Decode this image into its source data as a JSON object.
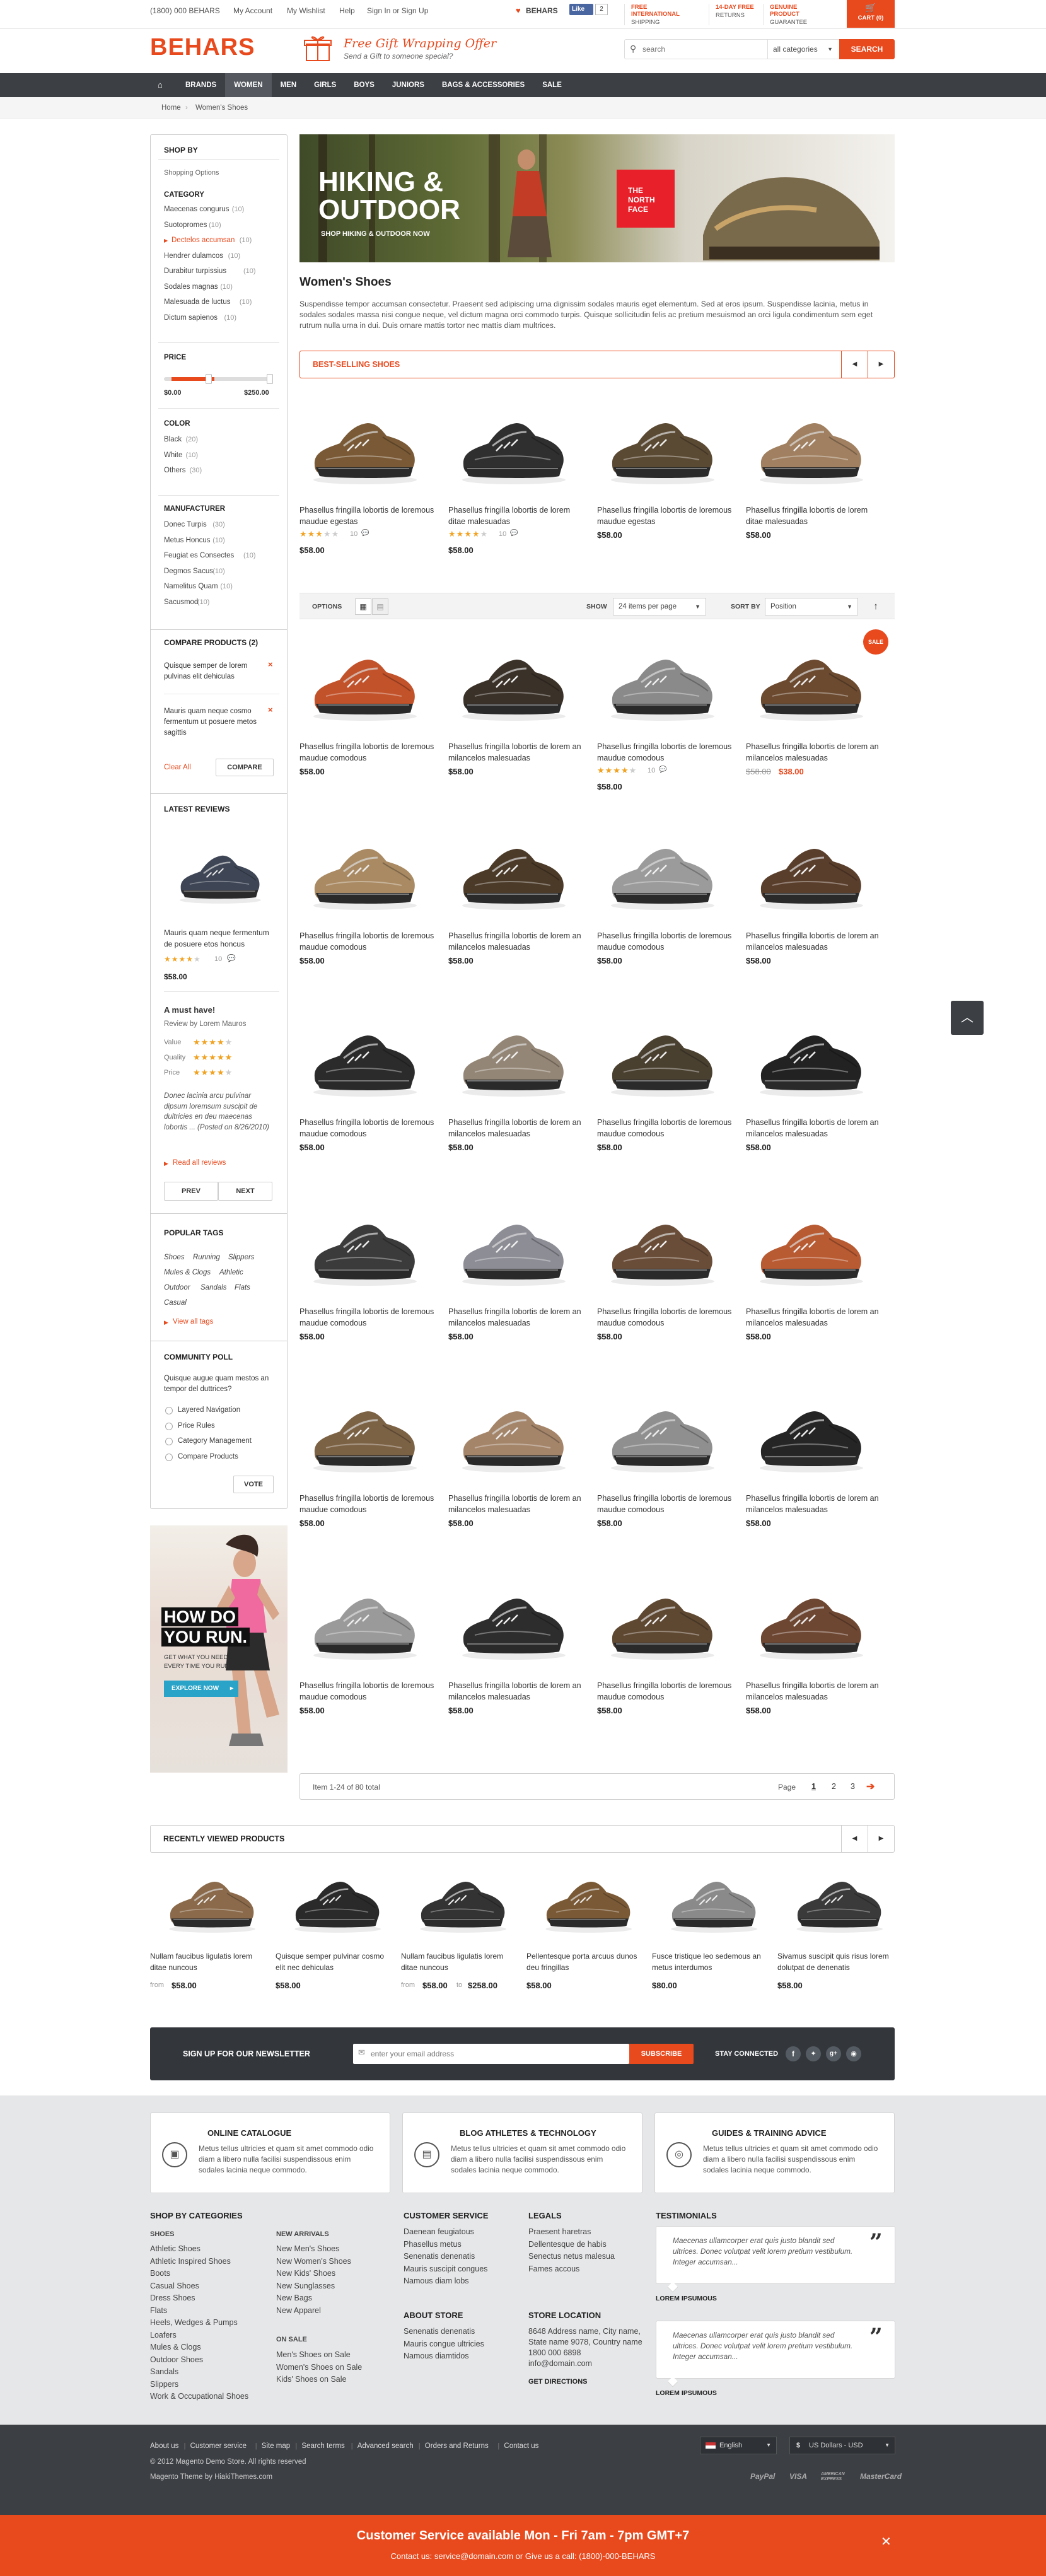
{
  "topbar": {
    "phone": "(1800) 000 BEHARS",
    "links": [
      "My Account",
      "My Wishlist",
      "Help",
      "Sign In or Sign Up"
    ],
    "like_brand": "BEHARS",
    "fb_like": "Like",
    "fb_count": "2",
    "promos": [
      {
        "l1": "FREE INTERNATIONAL",
        "l2": "SHIPPING"
      },
      {
        "l1": "14-DAY FREE",
        "l2": "RETURNS"
      },
      {
        "l1": "GENUINE PRODUCT",
        "l2": "GUARANTEE"
      }
    ],
    "cart": "CART (0)"
  },
  "header": {
    "logo": "BEHARS",
    "gift_title": "Free Gift Wrapping Offer",
    "gift_sub": "Send a Gift to someone special?",
    "search_placeholder": "search",
    "category": "all categories",
    "search_btn": "SEARCH"
  },
  "nav": {
    "items": [
      "BRANDS",
      "WOMEN",
      "MEN",
      "GIRLS",
      "BOYS",
      "JUNIORS",
      "BAGS & ACCESSORIES",
      "SALE"
    ],
    "active": "WOMEN"
  },
  "breadcrumb": [
    "Home",
    "Women's Shoes"
  ],
  "sidebar": {
    "shop_by": "SHOP BY",
    "shopping_options": "Shopping Options",
    "category_title": "CATEGORY",
    "categories": [
      {
        "name": "Maecenas congurus",
        "count": "(10)"
      },
      {
        "name": "Suotopromes",
        "count": "(10)"
      },
      {
        "name": "Dectelos accumsan",
        "count": "(10)",
        "active": true
      },
      {
        "name": "Hendrer dulamcos",
        "count": "(10)"
      },
      {
        "name": "Durabitur turpissius",
        "count": "(10)"
      },
      {
        "name": "Sodales magnas",
        "count": "(10)"
      },
      {
        "name": "Malesuada de luctus",
        "count": "(10)"
      },
      {
        "name": "Dictum sapienos",
        "count": "(10)"
      }
    ],
    "price_title": "PRICE",
    "price_min": "$0.00",
    "price_max": "$250.00",
    "price_range": [
      0.07,
      0.95
    ],
    "color_title": "COLOR",
    "colors": [
      {
        "name": "Black",
        "count": "(20)"
      },
      {
        "name": "White",
        "count": "(10)"
      },
      {
        "name": "Others",
        "count": "(30)"
      }
    ],
    "manufacturer_title": "MANUFACTURER",
    "manufacturers": [
      {
        "name": "Donec Turpis",
        "count": "(30)"
      },
      {
        "name": "Metus Honcus",
        "count": "(10)"
      },
      {
        "name": "Feugiat es Consectes",
        "count": "(10)"
      },
      {
        "name": "Degmos Sacus",
        "count": "(10)"
      },
      {
        "name": "Namelitus Quam",
        "count": "(10)"
      },
      {
        "name": "Sacusmod",
        "count": "(10)"
      }
    ],
    "compare_title": "COMPARE PRODUCTS (2)",
    "compare_items": [
      "Quisque semper de lorem pulvinas elit dehiculas",
      "Mauris quam neque cosmo fermentum ut posuere metos sagittis"
    ],
    "clear_all": "Clear All",
    "compare_btn": "COMPARE",
    "reviews_title": "LATEST REVIEWS",
    "review_product": "Mauris quam neque fermentum de posuere etos honcus",
    "review_count": "10",
    "review_price": "$58.00",
    "review_head": "A must have!",
    "review_by": "Review by Lorem Mauros",
    "ratings": [
      {
        "label": "Value",
        "stars": 4
      },
      {
        "label": "Quality",
        "stars": 5
      },
      {
        "label": "Price",
        "stars": 4
      }
    ],
    "review_text": "Donec lacinia arcu pulvinar dipsum loremsum suscipit de dultricies en deu maecenas lobortis ... (Posted on 8/26/2010)",
    "read_all": "Read all reviews",
    "prev": "PREV",
    "next": "NEXT",
    "tags_title": "POPULAR TAGS",
    "tags": [
      "Shoes",
      "Running",
      "Slippers",
      "Mules & Clogs",
      "Athletic",
      "Outdoor",
      "Sandals",
      "Flats",
      "Casual"
    ],
    "view_tags": "View all tags",
    "poll_title": "COMMUNITY POLL",
    "poll_q": "Quisque augue quam mestos an tempor del duttrices?",
    "poll_opts": [
      "Layered Navigation",
      "Price Rules",
      "Category Management",
      "Compare Products"
    ],
    "vote": "VOTE",
    "ad": {
      "title1": "HOW DO",
      "title2": "YOU RUN.",
      "sub1": "GET WHAT YOU NEED,",
      "sub2": "EVERY TIME YOU RUN.",
      "btn": "EXPLORE NOW"
    }
  },
  "banner": {
    "title1": "HIKING &",
    "title2": "OUTDOOR",
    "sub": "SHOP HIKING & OUTDOOR NOW",
    "brand1": "THE",
    "brand2": "NORTH",
    "brand3": "FACE"
  },
  "main": {
    "title": "Women's Shoes",
    "desc": "Suspendisse tempor accumsan consectetur. Praesent sed adipiscing urna dignissim sodales mauris eget elementum. Sed at eros ipsum. Suspendisse lacinia, metus in sodales sodales massa nisi congue neque, vel dictum magna orci commodo turpis. Quisque sollicitudin felis ac pretium mesuismod an orci ligula condimentum sem eget rutrum nulla urna in dui. Duis ornare mattis tortor nec mattis diam multrices.",
    "bestselling_title": "BEST-SELLING SHOES",
    "bestselling": [
      {
        "name": "Phasellus fringilla lobortis de loremous maudue egestas",
        "price": "$58.00",
        "stars": 3,
        "reviews": "10",
        "c": "#7a5a36"
      },
      {
        "name": "Phasellus fringilla lobortis de lorem ditae malesuadas",
        "price": "$58.00",
        "stars": 4,
        "reviews": "10",
        "c": "#2f2f2f"
      },
      {
        "name": "Phasellus fringilla lobortis de loremous maudue egestas",
        "price": "$58.00",
        "c": "#5b4a33"
      },
      {
        "name": "Phasellus fringilla lobortis de lorem ditae malesuadas",
        "price": "$58.00",
        "c": "#a08060"
      }
    ],
    "toolbar": {
      "options": "OPTIONS",
      "show": "SHOW",
      "per_page": "24 items per page",
      "sort_by": "SORT BY",
      "sort": "Position"
    },
    "products": [
      {
        "name": "Phasellus fringilla lobortis de loremous maudue comodous",
        "price": "$58.00",
        "c": "#c2522a"
      },
      {
        "name": "Phasellus fringilla lobortis de lorem an milancelos malesuadas",
        "price": "$58.00",
        "c": "#3a3128"
      },
      {
        "name": "Phasellus fringilla lobortis de loremous maudue comodous",
        "price": "$58.00",
        "stars": 4,
        "reviews": "10",
        "c": "#8a8a8a"
      },
      {
        "name": "Phasellus fringilla lobortis de lorem an milancelos malesuadas",
        "old_price": "$58.00",
        "price": "$38.00",
        "sale": "SALE",
        "c": "#6b4a30"
      },
      {
        "name": "Phasellus fringilla lobortis de loremous maudue comodous",
        "price": "$58.00",
        "c": "#a98a63"
      },
      {
        "name": "Phasellus fringilla lobortis de lorem an milancelos malesuadas",
        "price": "$58.00",
        "c": "#4b3a28"
      },
      {
        "name": "Phasellus fringilla lobortis de loremous maudue comodous",
        "price": "$58.00",
        "c": "#9b9b9b"
      },
      {
        "name": "Phasellus fringilla lobortis de lorem an milancelos malesuadas",
        "price": "$58.00",
        "c": "#5a3e2c"
      },
      {
        "name": "Phasellus fringilla lobortis de loremous maudue comodous",
        "price": "$58.00",
        "c": "#2b2b2b"
      },
      {
        "name": "Phasellus fringilla lobortis de lorem an milancelos malesuadas",
        "price": "$58.00",
        "c": "#948676"
      },
      {
        "name": "Phasellus fringilla lobortis de loremous maudue comodous",
        "price": "$58.00",
        "c": "#4a4030"
      },
      {
        "name": "Phasellus fringilla lobortis de lorem an milancelos malesuadas",
        "price": "$58.00",
        "c": "#222222"
      },
      {
        "name": "Phasellus fringilla lobortis de loremous maudue comodous",
        "price": "$58.00",
        "c": "#3b3b3b"
      },
      {
        "name": "Phasellus fringilla lobortis de lorem an milancelos malesuadas",
        "price": "$58.00",
        "c": "#8d8d96"
      },
      {
        "name": "Phasellus fringilla lobortis de loremous maudue comodous",
        "price": "$58.00",
        "c": "#6a4d38"
      },
      {
        "name": "Phasellus fringilla lobortis de lorem an milancelos malesuadas",
        "price": "$58.00",
        "c": "#b85a32"
      },
      {
        "name": "Phasellus fringilla lobortis de loremous maudue comodous",
        "price": "$58.00",
        "c": "#7c6245"
      },
      {
        "name": "Phasellus fringilla lobortis de lorem an milancelos malesuadas",
        "price": "$58.00",
        "c": "#a4856a"
      },
      {
        "name": "Phasellus fringilla lobortis de loremous maudue comodous",
        "price": "$58.00",
        "c": "#8f8f8f"
      },
      {
        "name": "Phasellus fringilla lobortis de lorem an milancelos malesuadas",
        "price": "$58.00",
        "c": "#252525"
      },
      {
        "name": "Phasellus fringilla lobortis de loremous maudue comodous",
        "price": "$58.00",
        "c": "#9a9a9a"
      },
      {
        "name": "Phasellus fringilla lobortis de lorem an milancelos malesuadas",
        "price": "$58.00",
        "c": "#2d2d2d"
      },
      {
        "name": "Phasellus fringilla lobortis de loremous maudue comodous",
        "price": "$58.00",
        "c": "#5e4832"
      },
      {
        "name": "Phasellus fringilla lobortis de lorem an milancelos malesuadas",
        "price": "$58.00",
        "c": "#6e4733"
      }
    ],
    "pager": {
      "total": "Item 1-24 of 80 total",
      "page": "Page",
      "pages": [
        "1",
        "2",
        "3"
      ],
      "current": "1"
    }
  },
  "recent": {
    "title": "RECENTLY VIEWED PRODUCTS",
    "items": [
      {
        "name": "Nullam faucibus ligulatis lorem ditae nuncous",
        "from": "from",
        "price": "$58.00",
        "c": "#8a6a4a"
      },
      {
        "name": "Quisque semper pulvinar cosmo elit nec dehiculas",
        "price": "$58.00",
        "c": "#2a2a2a"
      },
      {
        "name": "Nullam faucibus ligulatis lorem ditae nuncous",
        "from": "from",
        "price": "$58.00",
        "to": "to",
        "price2": "$258.00",
        "c": "#333333"
      },
      {
        "name": "Pellentesque porta arcuus dunos deu fringillas",
        "price": "$58.00",
        "c": "#7a5a36"
      },
      {
        "name": "Fusce tristique leo sedemous an metus interdumos",
        "price": "$80.00",
        "c": "#8a8a8a"
      },
      {
        "name": "Sivamus suscipit quis risus lorem dolutpat de denenatis",
        "price": "$58.00",
        "c": "#3a3a3a"
      }
    ]
  },
  "newsletter": {
    "title": "SIGN UP FOR OUR NEWSLETTER",
    "placeholder": "enter your email address",
    "btn": "SUBSCRIBE",
    "stay": "STAY CONNECTED"
  },
  "features": [
    {
      "title": "ONLINE CATALOGUE",
      "text": "Metus tellus ultricies et quam sit amet commodo odio diam a libero nulla facilisi suspendissous enim sodales lacinia neque commodo."
    },
    {
      "title": "BLOG ATHLETES & TECHNOLOGY",
      "text": "Metus tellus ultricies et quam sit amet commodo odio diam a libero nulla facilisi suspendissous enim sodales lacinia neque commodo."
    },
    {
      "title": "GUIDES & TRAINING ADVICE",
      "text": "Metus tellus ultricies et quam sit amet commodo odio diam a libero nulla facilisi suspendissous enim sodales lacinia neque commodo."
    }
  ],
  "footer": {
    "shop_title": "SHOP BY CATEGORIES",
    "shoes_title": "SHOES",
    "shoes": [
      "Athletic Shoes",
      "Athletic Inspired Shoes",
      "Boots",
      "Casual Shoes",
      "Dress Shoes",
      "Flats",
      "Heels, Wedges & Pumps",
      "Loafers",
      "Mules & Clogs",
      "Outdoor Shoes",
      "Sandals",
      "Slippers",
      "Work & Occupational Shoes"
    ],
    "arrivals_title": "NEW ARRIVALS",
    "arrivals": [
      "New Men's Shoes",
      "New Women's Shoes",
      "New Kids' Shoes",
      "New Sunglasses",
      "New Bags",
      "New Apparel"
    ],
    "sale_title": "ON SALE",
    "sale": [
      "Men's Shoes on Sale",
      "Women's Shoes on Sale",
      "Kids' Shoes on Sale"
    ],
    "cs_title": "CUSTOMER SERVICE",
    "cs": [
      "Daenean feugiatous",
      "Phasellus metus",
      "Senenatis denenatis",
      "Mauris suscipit congues",
      "Namous diam lobs"
    ],
    "legal_title": "LEGALS",
    "legal": [
      "Praesent haretras",
      "Dellentesque de habis",
      "Senectus netus malesua",
      "Fames accous"
    ],
    "about_title": "ABOUT STORE",
    "about": [
      "Senenatis denenatis",
      "Mauris congue ultricies",
      "Namous diamtidos"
    ],
    "loc_title": "STORE LOCATION",
    "loc": [
      "8648 Address name, City name,",
      "State name 9078, Country name",
      "1800 000 6898",
      "info@domain.com"
    ],
    "directions": "GET DIRECTIONS",
    "test_title": "TESTIMONIALS",
    "testimonials": [
      {
        "text": "Maecenas ullamcorper erat quis justo blandit sed ultrices. Donec volutpat velit lorem pretium vestibulum. Integer accumsan...",
        "author": "LOREM IPSUMOUS"
      },
      {
        "text": "Maecenas ullamcorper erat quis justo blandit sed ultrices. Donec volutpat velit lorem pretium vestibulum. Integer accumsan...",
        "author": "LOREM IPSUMOUS"
      }
    ],
    "bottom_links": [
      "About us",
      "Customer service",
      "Site map",
      "Search terms",
      "Advanced search",
      "Orders and Returns",
      "Contact us"
    ],
    "copyright": "© 2012 Magento Demo Store. All rights reserved",
    "theme": "Magento Theme by HiakiThemes.com",
    "lang": "English",
    "currency": "US Dollars - USD",
    "payments": [
      "PayPal",
      "VISA",
      "AMERICAN EXPRESS",
      "MasterCard"
    ]
  },
  "cs_bar": {
    "title": "Customer Service available Mon - Fri 7am - 7pm GMT+7",
    "sub": "Contact us: service@domain.com or Give us a call: (1800)-000-BEHARS"
  },
  "colors": {
    "accent": "#e8491d",
    "nav": "#3c3f44",
    "dark": "#33373c",
    "footer_bg": "#e6e7e9"
  }
}
